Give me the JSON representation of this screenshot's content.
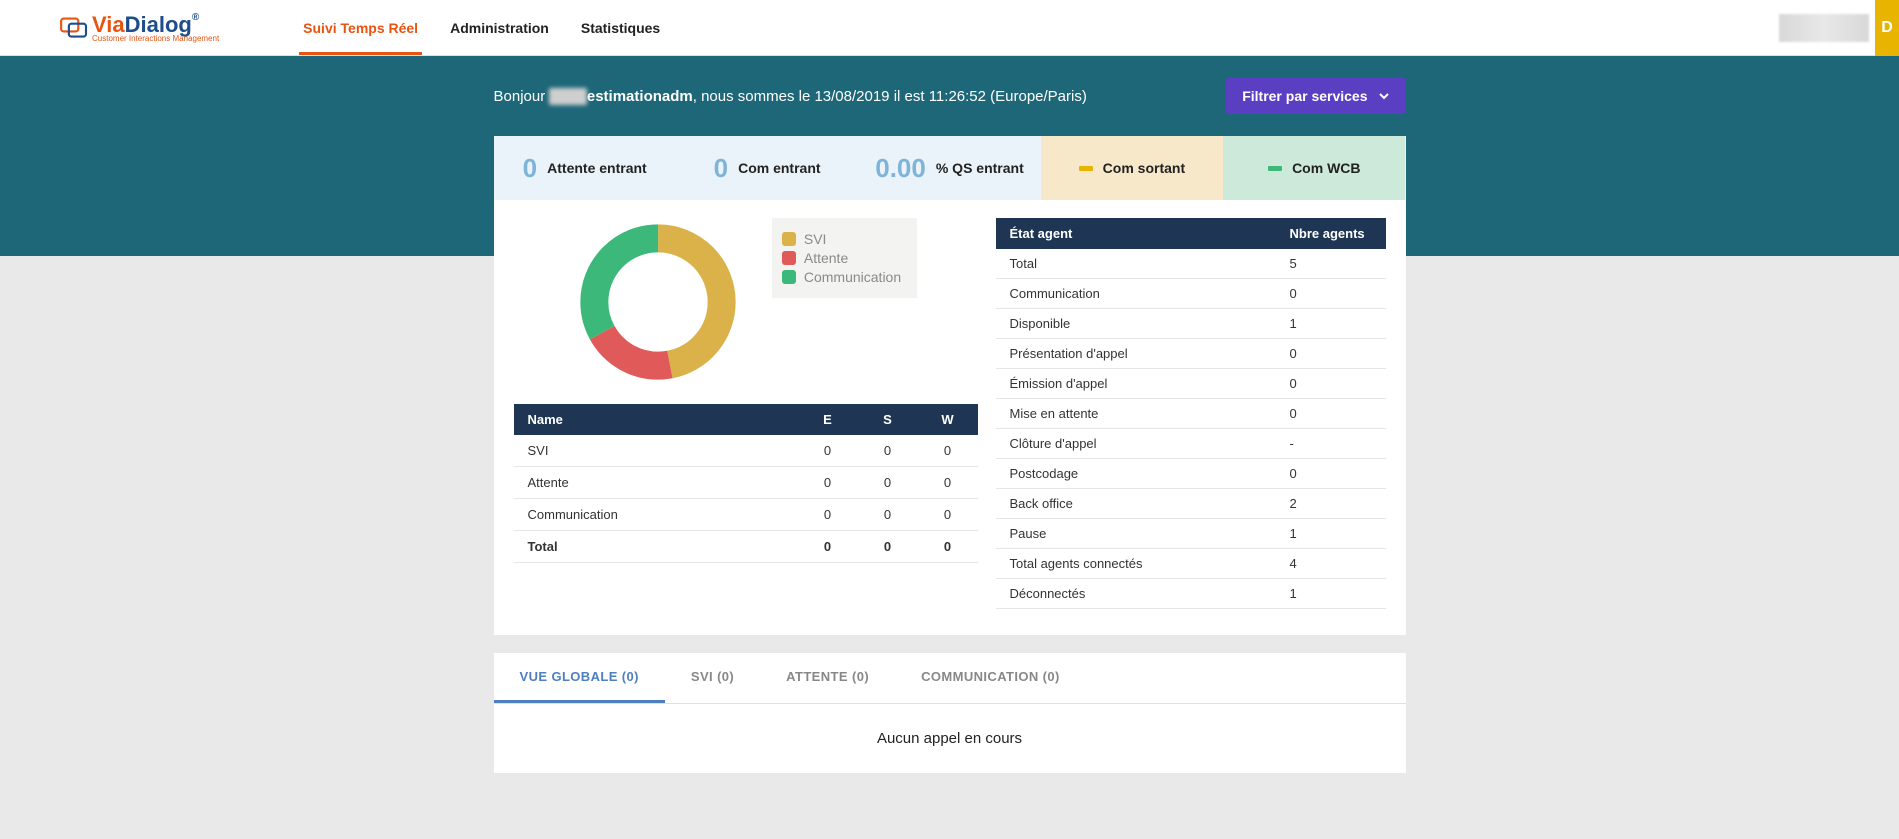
{
  "brand": {
    "via": "Via",
    "dialog": "Dialog",
    "sub": "Customer Interactions Management"
  },
  "nav": {
    "realtime": "Suivi Temps Réel",
    "admin": "Administration",
    "stats": "Statistiques"
  },
  "user_initial": "D",
  "greeting": {
    "prefix": "Bonjour ",
    "obscured": "xxxxx",
    "username_suffix": "estimationadm",
    "rest": ", nous sommes le 13/08/2019 il est 11:26:52 (Europe/Paris)"
  },
  "filter_btn": "Filtrer par services",
  "kpis": {
    "attente_entrant": {
      "value": "0",
      "label": "Attente entrant"
    },
    "com_entrant": {
      "value": "0",
      "label": "Com entrant"
    },
    "qs_entrant": {
      "value": "0.00",
      "label": "% QS entrant"
    },
    "com_sortant": {
      "value": "",
      "label": "Com sortant"
    },
    "com_wcb": {
      "value": "",
      "label": "Com WCB"
    }
  },
  "legend": {
    "svi": "SVI",
    "attente": "Attente",
    "communication": "Communication"
  },
  "colors": {
    "svi": "#dbb24a",
    "attente": "#e05a5a",
    "communication": "#3cb97a"
  },
  "chart_data": {
    "type": "pie",
    "title": "",
    "series": [
      {
        "name": "SVI",
        "value": 47,
        "color": "#dbb24a"
      },
      {
        "name": "Attente",
        "value": 20,
        "color": "#e05a5a"
      },
      {
        "name": "Communication",
        "value": 33,
        "color": "#3cb97a"
      }
    ]
  },
  "call_table": {
    "headers": {
      "name": "Name",
      "e": "E",
      "s": "S",
      "w": "W"
    },
    "rows": [
      {
        "name": "SVI",
        "e": "0",
        "s": "0",
        "w": "0"
      },
      {
        "name": "Attente",
        "e": "0",
        "s": "0",
        "w": "0"
      },
      {
        "name": "Communication",
        "e": "0",
        "s": "0",
        "w": "0"
      },
      {
        "name": "Total",
        "e": "0",
        "s": "0",
        "w": "0"
      }
    ]
  },
  "agent_table": {
    "headers": {
      "state": "État agent",
      "count": "Nbre agents"
    },
    "rows": [
      {
        "state": "Total",
        "count": "5"
      },
      {
        "state": "Communication",
        "count": "0"
      },
      {
        "state": "Disponible",
        "count": "1"
      },
      {
        "state": "Présentation d'appel",
        "count": "0"
      },
      {
        "state": "Émission d'appel",
        "count": "0"
      },
      {
        "state": "Mise en attente",
        "count": "0"
      },
      {
        "state": "Clôture d'appel",
        "count": "-"
      },
      {
        "state": "Postcodage",
        "count": "0"
      },
      {
        "state": "Back office",
        "count": "2"
      },
      {
        "state": "Pause",
        "count": "1"
      },
      {
        "state": "Total agents connectés",
        "count": "4"
      },
      {
        "state": "Déconnectés",
        "count": "1"
      }
    ]
  },
  "tabs": {
    "global": "VUE GLOBALE (0)",
    "svi": "SVI (0)",
    "attente": "ATTENTE (0)",
    "communication": "COMMUNICATION (0)"
  },
  "empty_msg": "Aucun appel en cours"
}
